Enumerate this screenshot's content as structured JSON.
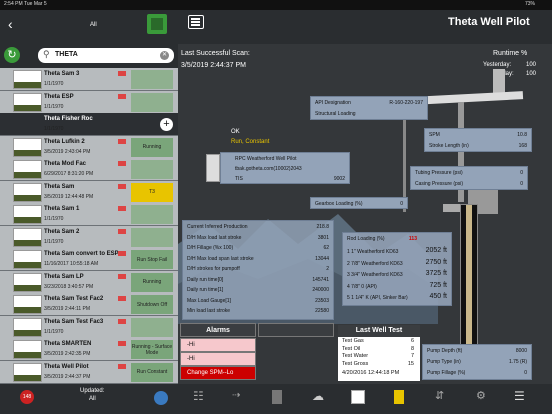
{
  "status": {
    "time": "2:54 PM",
    "date": "Tue Mar 5",
    "battery": "73%"
  },
  "nav": {
    "back_icon": "chevron-left-icon",
    "filter_label": "All",
    "menu_icon": "menu-icon"
  },
  "app_title": "Theta Well Pilot",
  "search": {
    "value": "THETA"
  },
  "wells": [
    {
      "name": "Theta Sam 3",
      "date": "1/1/1970",
      "status": "",
      "style": "light"
    },
    {
      "name": "Theta ESP",
      "date": "1/1/1970",
      "status": "",
      "style": "light"
    },
    {
      "name": "Theta Fisher Roc",
      "date": "1/1/1970",
      "status": "",
      "style": "dark"
    },
    {
      "name": "Theta Lufkin 2",
      "date": "3/5/2019 2:43:04 PM",
      "status": "Running",
      "style": "light"
    },
    {
      "name": "Theta Mod Fac",
      "date": "6/29/2017 8:31:20 PM",
      "status": "",
      "style": "light"
    },
    {
      "name": "Theta Sam",
      "date": "3/5/2019 12:44:48 PM",
      "status": "T3",
      "style": "light"
    },
    {
      "name": "Theta Sam 1",
      "date": "1/1/1970",
      "status": "",
      "style": "light"
    },
    {
      "name": "Theta Sam 2",
      "date": "1/1/1970",
      "status": "",
      "style": "light"
    },
    {
      "name": "Theta Sam convert to ESP",
      "date": "11/16/2017 10:55:18 AM",
      "status": "Run Stop Fail",
      "style": "light"
    },
    {
      "name": "Theta Sam LP",
      "date": "3/23/2018 3:40:57 PM",
      "status": "Running",
      "style": "light"
    },
    {
      "name": "Theta Sam Test Fac2",
      "date": "3/5/2019 2:44:11 PM",
      "status": "Shutdown Off",
      "style": "light"
    },
    {
      "name": "Theta Sam Test Fac3",
      "date": "1/1/1970",
      "status": "",
      "style": "light"
    },
    {
      "name": "Theta SMARTEN",
      "date": "3/5/2019 2:42:35 PM",
      "status": "Running - Surface Mode",
      "style": "light"
    },
    {
      "name": "Theta Well Pilot",
      "date": "3/5/2019 2:44:37 PM",
      "status": "Run Constant",
      "style": "light"
    }
  ],
  "bottom": {
    "badge": "148",
    "updated_label": "Updated:",
    "updated_value": "All"
  },
  "scan": {
    "label": "Last Successful Scan:",
    "value": "3/5/2019 2:44:37 PM"
  },
  "runtime": {
    "label": "Runtime %",
    "yesterday_label": "Yesterday:",
    "yesterday": "100",
    "today_label": "Today:",
    "today": "100"
  },
  "controller": {
    "status1": "OK",
    "status2": "Run, Constant"
  },
  "api": {
    "label1": "API Designation",
    "val1": "R-160-220-197",
    "label2": "Structural Loading",
    "val2": ""
  },
  "pilot": {
    "title": "RPC Weatherford Well Pilot",
    "host": "tbak.gotheta.com(10002)2043",
    "tis_label": "TIS",
    "tis_val": "9002"
  },
  "spm": {
    "label1": "SPM",
    "val1": "10.8",
    "label2": "Stroke Length (in)",
    "val2": "168"
  },
  "pressure": {
    "tubing": "Tubing Pressure (psi)",
    "tubing_val": "0",
    "casing": "Casing Pressure (psi)",
    "casing_val": "0"
  },
  "gearbox": {
    "label": "Gearbox Loading (%)",
    "val": "0"
  },
  "production": {
    "rows": [
      {
        "label": "Current Inferred Production",
        "val": "218.8"
      },
      {
        "label": "D/H Max load last stroke",
        "val": "3801"
      },
      {
        "label": "D/H Fillage (%x 100)",
        "val": "62"
      },
      {
        "label": "D/H Max load span last stroke",
        "val": "13044"
      },
      {
        "label": "D/H strokes for pumpoff",
        "val": "2"
      },
      {
        "label": "Daily run time[0]",
        "val": "145741"
      },
      {
        "label": "Daily run time[1]",
        "val": "240000"
      },
      {
        "label": "Max Load Gauge[1]",
        "val": "23503"
      },
      {
        "label": "Min load last stroke",
        "val": "22580"
      }
    ]
  },
  "rod": {
    "title": "Rod Loading (%)",
    "title_val": "113",
    "rows": [
      {
        "label": "1 1\" Weatherford KD63",
        "val": "2052 ft"
      },
      {
        "label": "2 7/8\" Weatherford KD63",
        "val": "2750 ft"
      },
      {
        "label": "3 3/4\" Weatherford KD63",
        "val": "3725 ft"
      },
      {
        "label": "4 7/8\" 0 (API)",
        "val": "725 ft"
      },
      {
        "label": "5 1 1/4\" K (API, Sinker Bar)",
        "val": "450 ft"
      }
    ]
  },
  "alarms": {
    "title": "Alarms",
    "items": [
      "-Hi",
      "-Hi",
      "Change SPM--Lo"
    ]
  },
  "welltest": {
    "title": "Last Well Test",
    "rows": [
      {
        "label": "Test Gas",
        "val": "6"
      },
      {
        "label": "Test Oil",
        "val": "8"
      },
      {
        "label": "Test Water",
        "val": "7"
      },
      {
        "label": "Test Gross",
        "val": "15"
      }
    ],
    "date": "4/20/2016 12:44:18 PM"
  },
  "pump": {
    "rows": [
      {
        "label": "Pump Depth (ft)",
        "val": "8000"
      },
      {
        "label": "Pump Type (in)",
        "val": "1.75 (R)"
      },
      {
        "label": "Pump Fillage (%)",
        "val": "0"
      }
    ]
  },
  "colors": {
    "accent_green": "#3a9a3a",
    "red": "#cc0000",
    "panel": "#93a3b8",
    "yellow": "#e8c400"
  }
}
